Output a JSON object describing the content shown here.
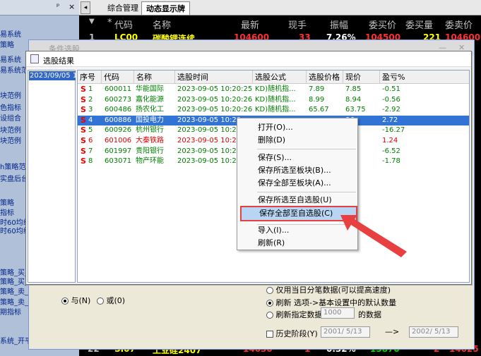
{
  "left_panel": {
    "pin": "p",
    "close": "×",
    "items": [
      "易系统",
      "策略",
      "易系统",
      "易系统范",
      "",
      "块范例",
      "色指标",
      "设组合",
      "块范例",
      "块范例",
      "",
      "h策略范",
      "实盘后台",
      "",
      "策略",
      "指标",
      "时60均线",
      "时60均线",
      "",
      "策略_买_2",
      "策略_买_最新版",
      "策略_卖_202312",
      "策略_卖_最新版",
      "期指标",
      "",
      "系统_开平仓策略"
    ]
  },
  "market": {
    "tabs": [
      "综合管理",
      "动态显示牌"
    ],
    "header": [
      "代码",
      "名称",
      "最新",
      "现手",
      "振幅",
      "委买价",
      "委买量",
      "委卖价"
    ],
    "row_top": {
      "idx": "1",
      "code": "LC00",
      "name": "碳酸锂连续",
      "last": "104600",
      "vol": "33",
      "amp": "7.26%",
      "bid": "104500",
      "bidvol": "221",
      "ask": "104600"
    },
    "row_bottom": {
      "idx": "22",
      "code": "SI07",
      "name": "工业硅2407",
      "last": "14030",
      "vol": "1",
      "amp": "0.32%",
      "bid": "13870",
      "bidvol": "2",
      "ask": "14025"
    }
  },
  "cond_window": {
    "title": "条件选股",
    "radio_and": "与(N)",
    "radio_or": "或(0)",
    "opt1": "仅用当日分笔数据(可以提高速度)",
    "opt2": "刷新 选项->基本设置中的默认数量",
    "opt3_pre": "刷新指定数据",
    "opt3_val": "1000",
    "opt3_post": "的数据",
    "history": "历史阶段(Y)",
    "date_from": "2001/ 5/13",
    "arrow": "—>",
    "date_to": "2002/ 5/13"
  },
  "result_window": {
    "title": "选股结果",
    "date_item": "2023/09/05 1(",
    "columns": [
      "序号",
      "代码",
      "名称",
      "选股时间",
      "选股公式",
      "选股价格",
      "现价",
      "盈亏%"
    ],
    "rows": [
      {
        "s": "S",
        "n": "1",
        "code": "600011",
        "name": "华能国际",
        "time": "2023-09-05 10:20:25",
        "formula": "KD)随机指...",
        "price": "7.89",
        "now": "7.85",
        "pl": "-0.51",
        "color": "#008000"
      },
      {
        "s": "S",
        "n": "2",
        "code": "600273",
        "name": "嘉化能源",
        "time": "2023-09-05 10:20:26",
        "formula": "KD)随机指...",
        "price": "8.99",
        "now": "8.94",
        "pl": "-0.56",
        "color": "#008000"
      },
      {
        "s": "S",
        "n": "3",
        "code": "600486",
        "name": "扬农化工",
        "time": "2023-09-05 10:20:26",
        "formula": "KD)随机指...",
        "price": "65.67",
        "now": "63.75",
        "pl": "-2.92",
        "color": "#008000"
      },
      {
        "s": "S",
        "n": "4",
        "code": "600886",
        "name": "国投电力",
        "time": "2023-09-05 10:20",
        "formula": "",
        "price": "",
        "now": "86",
        "pl": "2.72",
        "color": "#ffffff"
      },
      {
        "s": "S",
        "n": "5",
        "code": "600926",
        "name": "杭州银行",
        "time": "2023-09-05 10:20",
        "formula": "",
        "price": "",
        "now": "",
        "pl": "-16.27",
        "color": "#008000"
      },
      {
        "s": "S",
        "n": "6",
        "code": "601006",
        "name": "大秦铁路",
        "time": "2023-09-05 10:20",
        "formula": "",
        "price": "",
        "now": "3",
        "pl": "1.24",
        "color": "#e00000"
      },
      {
        "s": "S",
        "n": "7",
        "code": "601997",
        "name": "贵阳银行",
        "time": "2023-09-05 10:20",
        "formula": "",
        "price": "",
        "now": "",
        "pl": "-6.52",
        "color": "#008000"
      },
      {
        "s": "S",
        "n": "8",
        "code": "603071",
        "name": "物产环能",
        "time": "2023-09-05 10:20",
        "formula": "",
        "price": "",
        "now": "46",
        "pl": "-1.78",
        "color": "#008000"
      }
    ]
  },
  "context_menu": {
    "items": [
      "打开(O)...",
      "删除(D)",
      "保存(S)...",
      "保存所选至板块(B)...",
      "保存全部至板块(A)...",
      "保存所选至自选股(U)",
      "保存全部至自选股(C)",
      "导入(I)...",
      "刷新(R)"
    ]
  },
  "colors": {
    "highlight_border": "#e84040",
    "arrow": "#e84040",
    "selection": "#3174d6"
  }
}
